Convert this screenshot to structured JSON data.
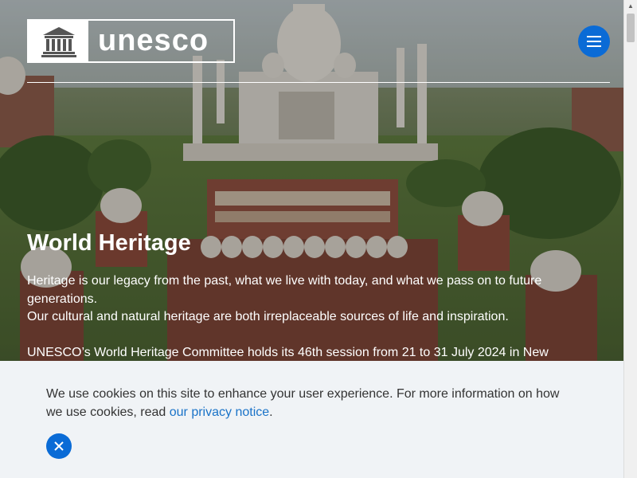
{
  "header": {
    "logo_text": "unesco",
    "menu_icon": "hamburger-icon"
  },
  "hero": {
    "title": "World Heritage",
    "paragraph_1": "Heritage is our legacy from the past, what we live with today, and what we pass on to future generations.",
    "paragraph_2": "Our cultural and natural heritage are both irreplaceable sources of life and inspiration.",
    "paragraph_3": "UNESCO’s World Heritage Committee holds its 46th session from 21 to 31 July 2024 in New"
  },
  "cookie_banner": {
    "text_before_link": "We use cookies on this site to enhance your user experience. For more information on how we use cookies, read ",
    "link_text": "our privacy notice",
    "text_after_link": ".",
    "close_icon": "close-icon"
  },
  "colors": {
    "accent": "#0a6bd6",
    "link": "#1a73c8",
    "banner_bg": "#f0f3f6"
  }
}
